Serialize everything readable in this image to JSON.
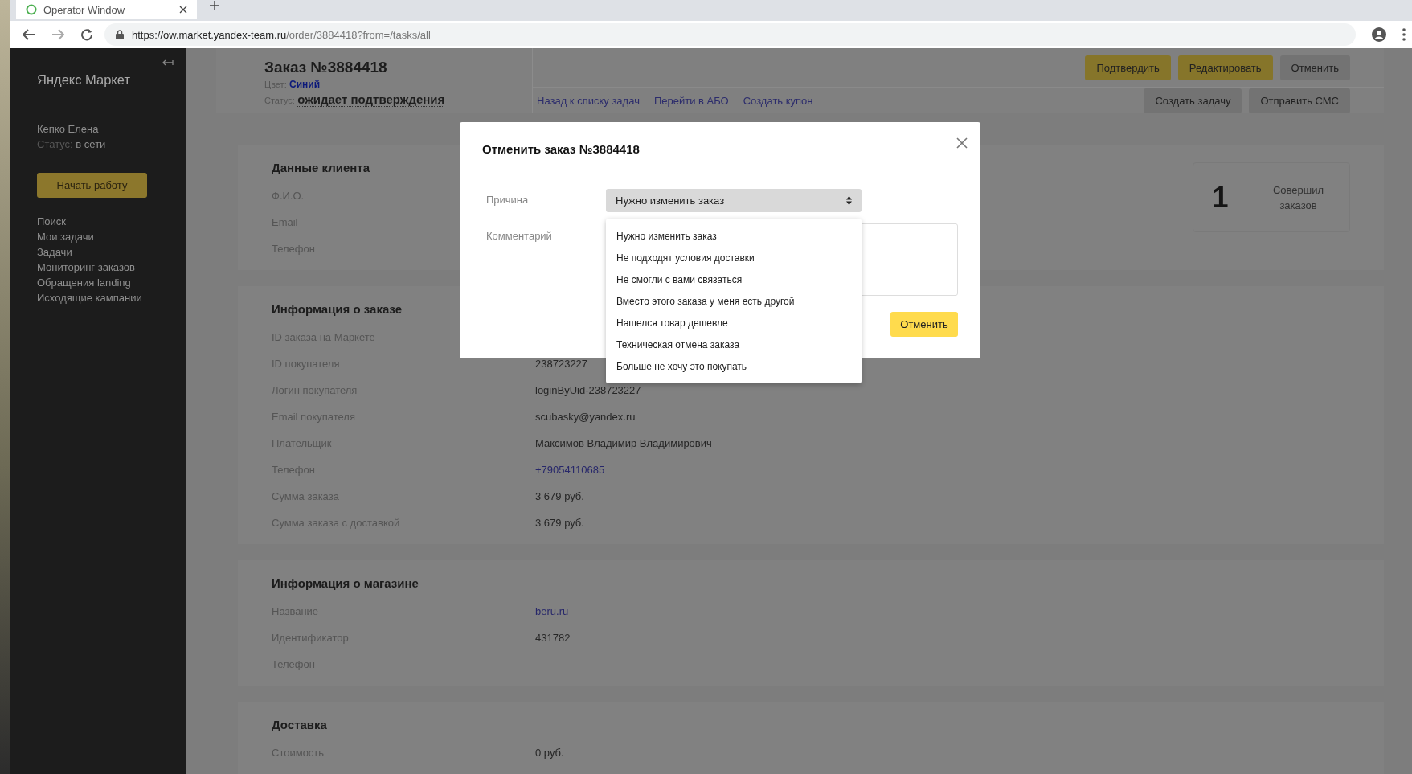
{
  "browser": {
    "tab_title": "Operator Window",
    "url_host": "https://ow.market.yandex-team.ru",
    "url_path": "/order/3884418?from=/tasks/all"
  },
  "sidebar": {
    "brand": "Яндекс Маркет",
    "user": "Кепко Елена",
    "status_label": "Статус:",
    "status_value": "в сети",
    "start_button": "Начать работу",
    "nav": [
      "Поиск",
      "Мои задачи",
      "Задачи",
      "Мониторинг заказов",
      "Обращения landing",
      "Исходящие кампании"
    ]
  },
  "order_header": {
    "title": "Заказ №3884418",
    "color_label": "Цвет:",
    "color_value": "Синий",
    "status_label": "Статус:",
    "status_value": "ожидает подтверждения",
    "links": [
      "Назад к списку задач",
      "Перейти в АБО",
      "Создать купон"
    ],
    "actions_top": [
      {
        "label": "Подтвердить",
        "kind": "primary"
      },
      {
        "label": "Редактировать",
        "kind": "primary"
      },
      {
        "label": "Отменить",
        "kind": "secondary"
      }
    ],
    "actions_bottom": [
      {
        "label": "Создать задачу",
        "kind": "secondary"
      },
      {
        "label": "Отправить СМС",
        "kind": "secondary"
      }
    ]
  },
  "sections": [
    {
      "title": "Данные клиента",
      "rows": [
        {
          "label": "Ф.И.О."
        },
        {
          "label": "Email"
        },
        {
          "label": "Телефон"
        }
      ],
      "stat": {
        "value": "1",
        "caption": "Совершил заказов"
      }
    },
    {
      "title": "Информация о заказе",
      "rows": [
        {
          "label": "ID заказа на Маркете"
        },
        {
          "label": "ID покупателя",
          "value": "238723227",
          "kind": "text"
        },
        {
          "label": "Логин покупателя",
          "value": "loginByUid-238723227",
          "kind": "text"
        },
        {
          "label": "Email покупателя",
          "value": "scubasky@yandex.ru",
          "kind": "text"
        },
        {
          "label": "Плательщик",
          "value": "Максимов Владимир Владимирович",
          "kind": "text"
        },
        {
          "label": "Телефон",
          "value": "+79054110685",
          "kind": "link"
        },
        {
          "label": "Сумма заказа",
          "value": "3 679 руб.",
          "kind": "text"
        },
        {
          "label": "Сумма заказа с доставкой",
          "value": "3 679 руб.",
          "kind": "text"
        }
      ]
    },
    {
      "title": "Информация о магазине",
      "rows": [
        {
          "label": "Название",
          "value": "beru.ru",
          "kind": "link"
        },
        {
          "label": "Идентификатор",
          "value": "431782",
          "kind": "text"
        },
        {
          "label": "Телефон"
        }
      ]
    },
    {
      "title": "Доставка",
      "rows": [
        {
          "label": "Стоимость",
          "value": "0 руб.",
          "kind": "text"
        }
      ]
    }
  ],
  "modal": {
    "title": "Отменить заказ №3884418",
    "reason_label": "Причина",
    "reason_value": "Нужно изменить заказ",
    "comment_label": "Комментарий",
    "submit": "Отменить",
    "options": [
      "Нужно изменить заказ",
      "Не подходят условия доставки",
      "Не смогли с вами связаться",
      "Вместо этого заказа у меня есть другой",
      "Нашелся товар дешевле",
      "Техническая отмена заказа",
      "Больше не хочу это покупать"
    ]
  }
}
